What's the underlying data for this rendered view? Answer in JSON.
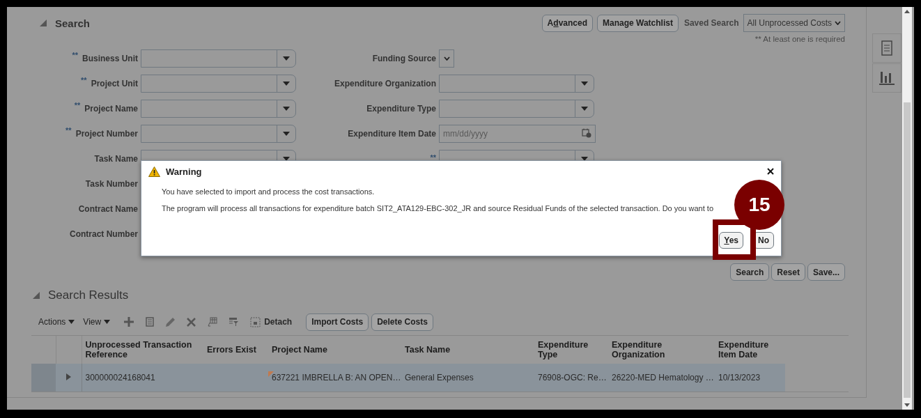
{
  "search": {
    "title": "Search",
    "expanded": true,
    "header_buttons": [
      {
        "parts": [
          {
            "text": "A"
          },
          {
            "text": "d",
            "underlined": true
          },
          {
            "text": "vanced"
          }
        ]
      },
      {
        "parts": [
          {
            "text": "Manage Watchlist"
          }
        ]
      }
    ],
    "saved_search": {
      "label": "Saved Search",
      "value": "All Unprocessed Costs"
    },
    "note": "** At least one is required",
    "left_fields": [
      {
        "label": "Business Unit",
        "required_marker": "**",
        "kind": "dropdown"
      },
      {
        "label": "Project Unit",
        "required_marker": "**",
        "kind": "dropdown"
      },
      {
        "label": "Project Name",
        "required_marker": "**",
        "kind": "dropdown"
      },
      {
        "label": "Project Number",
        "required_marker": "**",
        "kind": "dropdown"
      },
      {
        "label": "Task Name",
        "kind": "dropdown"
      },
      {
        "label": "Task Number",
        "kind": "covered"
      },
      {
        "label": "Contract Name",
        "kind": "covered"
      },
      {
        "label": "Contract Number",
        "kind": "covered"
      }
    ],
    "right_fields": [
      {
        "label": "Funding Source",
        "kind": "small_dropdown"
      },
      {
        "label": "Expenditure Organization",
        "kind": "dropdown"
      },
      {
        "label": "Expenditure Type",
        "kind": "dropdown"
      },
      {
        "label": "Expenditure Item Date",
        "kind": "date",
        "placeholder": "mm/dd/yyyy"
      },
      {
        "required_marker": "**",
        "kind": "dropdown"
      }
    ],
    "actions": [
      "Search",
      "Reset",
      "Save..."
    ]
  },
  "results": {
    "title": "Search Results",
    "expanded": true,
    "menus": [
      "Actions",
      "View"
    ],
    "detach": "Detach",
    "buttons": [
      "Import Costs",
      "Delete Costs"
    ],
    "columns": [
      "Unprocessed Transaction Reference",
      "Errors Exist",
      "Project Name",
      "Task Name",
      "Expenditure Type",
      "Expenditure Organization",
      "Expenditure Item Date"
    ],
    "rows": [
      {
        "selected": true,
        "expanded": false,
        "cells": [
          {
            "text": "300000024168041"
          },
          {},
          {
            "text": "637221 IMBRELLA B: AN OPEN…",
            "marked": true
          },
          {
            "text": "General Expenses"
          },
          {
            "text": "76908-OGC: Re…"
          },
          {
            "text": "26220-MED Hematology …"
          },
          {
            "text": "10/13/2023"
          }
        ]
      }
    ]
  },
  "dialog": {
    "title": "Warning",
    "messages": [
      "You have selected to import and process the cost transactions.",
      "The program will process all transactions for expenditure batch SIT2_ATA129-EBC-302_JR and source Residual Funds of the selected transaction. Do you want to"
    ],
    "buttons": [
      {
        "parts": [
          {
            "text": "Y",
            "underlined": true
          },
          {
            "text": "es"
          }
        ]
      },
      {
        "parts": [
          {
            "text": "No"
          }
        ]
      }
    ]
  },
  "callout": {
    "number": "15"
  }
}
